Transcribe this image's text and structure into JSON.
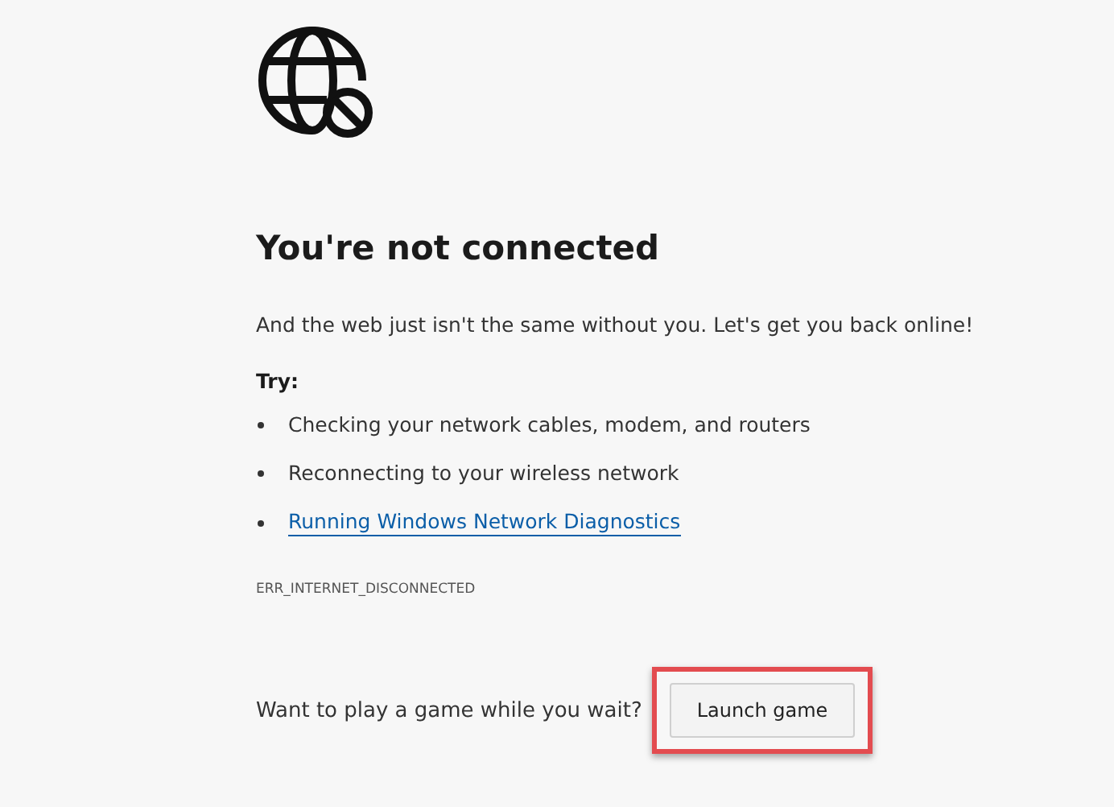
{
  "title": "You're not connected",
  "message": "And the web just isn't the same without you. Let's get you back online!",
  "try_heading": "Try:",
  "suggestions": [
    {
      "kind": "text",
      "text": "Checking your network cables, modem, and routers"
    },
    {
      "kind": "text",
      "text": "Reconnecting to your wireless network"
    },
    {
      "kind": "link",
      "text": "Running Windows Network Diagnostics"
    }
  ],
  "error_code": "ERR_INTERNET_DISCONNECTED",
  "game": {
    "prompt": "Want to play a game while you wait?",
    "button": "Launch game",
    "highlighted": true
  }
}
